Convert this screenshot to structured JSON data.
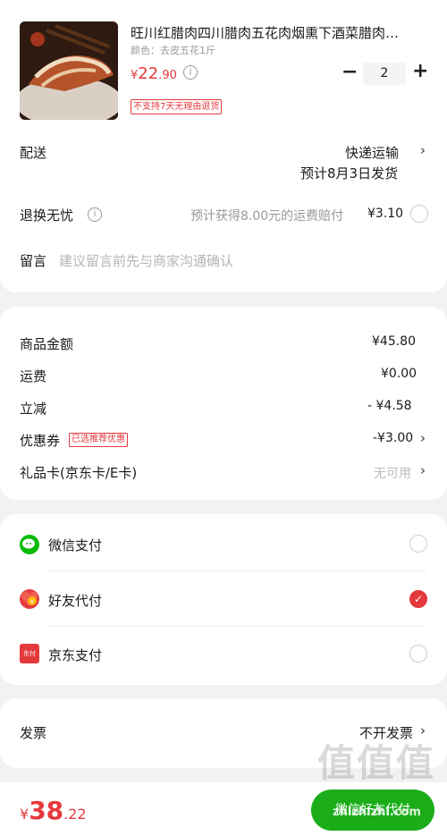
{
  "product": {
    "title": "旺川红腊肉四川腊肉五花肉烟熏下酒菜腊肉…",
    "variant": "颜色：去皮五花1斤",
    "price_symbol": "¥",
    "price_int": "22",
    "price_dec": ".90",
    "quantity": "2",
    "minus": "−",
    "plus": "+",
    "no_return_badge": "不支持7天无理由退货"
  },
  "shipping": {
    "label": "配送",
    "method": "快递运输",
    "eta": "预计8月3日发货"
  },
  "return_worry_free": {
    "label": "退换无忧",
    "desc": "预计获得8.00元的运费赔付",
    "price": "¥3.10"
  },
  "message": {
    "label": "留言",
    "placeholder": "建议留言前先与商家沟通确认"
  },
  "summary": {
    "goods_label": "商品金额",
    "goods_value": "¥45.80",
    "freight_label": "运费",
    "freight_value": "¥0.00",
    "discount_label": "立减",
    "discount_value": "- ¥4.58",
    "coupon_label": "优惠券",
    "coupon_tag": "已选推荐优惠",
    "coupon_value": "-¥3.00",
    "giftcard_label": "礼品卡(京东卡/E卡)",
    "giftcard_value": "无可用"
  },
  "payment": {
    "wechat": "微信支付",
    "friend": "好友代付",
    "jd": "京东支付",
    "jd_icon_text": "东付",
    "friend_icon_text": "¥"
  },
  "invoice": {
    "label": "发票",
    "value": "不开发票"
  },
  "footer": {
    "total_symbol": "¥",
    "total_int": "38",
    "total_dec": ".22",
    "pay_button": "微信好友代付"
  },
  "watermark": {
    "logo": "值值值",
    "url": "zhizhizhi.com"
  },
  "icons": {
    "chevron": "›",
    "info": "i",
    "check": "✓"
  },
  "colors": {
    "accent": "#e4393c",
    "wechat_green": "#09bb07"
  }
}
